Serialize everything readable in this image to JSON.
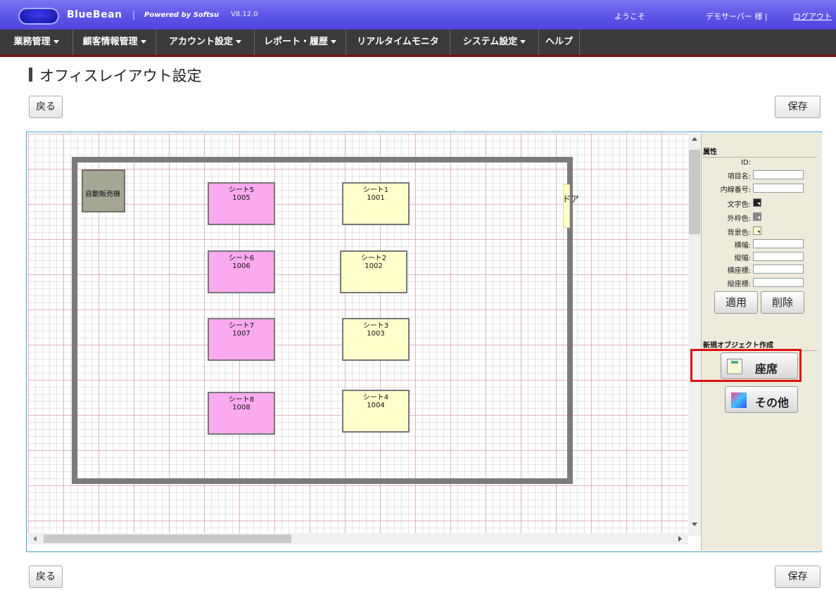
{
  "header": {
    "brand": "BlueBean",
    "separator": "|",
    "powered": "Powered by Softsu",
    "version": "V8.12.0",
    "welcome": "ようこそ",
    "user": "デモサーバー 様 |",
    "logout": "ログアウト",
    "colors": {
      "header_bg": "#5b52e6",
      "nav_bg": "#3a3a3a"
    }
  },
  "nav": {
    "items": [
      {
        "label": "業務管理",
        "dropdown": true
      },
      {
        "label": "顧客情報管理",
        "dropdown": true
      },
      {
        "label": "アカウント設定",
        "dropdown": true
      },
      {
        "label": "レポート・履歴",
        "dropdown": true
      },
      {
        "label": "リアルタイムモニタ",
        "dropdown": false
      },
      {
        "label": "システム設定",
        "dropdown": true
      },
      {
        "label": "ヘルプ",
        "dropdown": false
      }
    ]
  },
  "page": {
    "title": "オフィスレイアウト設定",
    "back_label": "戻る",
    "save_label": "保存"
  },
  "layout": {
    "vending_label": "自動販売機",
    "door_label": "ドア",
    "seats": [
      {
        "name": "シート5",
        "ext": "1005",
        "color": "pink"
      },
      {
        "name": "シート1",
        "ext": "1001",
        "color": "yellow"
      },
      {
        "name": "シート6",
        "ext": "1006",
        "color": "pink"
      },
      {
        "name": "シート2",
        "ext": "1002",
        "color": "yellow"
      },
      {
        "name": "シート7",
        "ext": "1007",
        "color": "pink"
      },
      {
        "name": "シート3",
        "ext": "1003",
        "color": "yellow"
      },
      {
        "name": "シート8",
        "ext": "1008",
        "color": "pink"
      },
      {
        "name": "シート4",
        "ext": "1004",
        "color": "yellow"
      }
    ],
    "colors": {
      "pink": "#fbaaf0",
      "yellow": "#ffffcc",
      "wall": "#7b7b7b",
      "vending": "#a6a694"
    }
  },
  "panel": {
    "heading": "属性",
    "id_label": "ID:",
    "item_name_label": "項目名:",
    "extension_label": "内線番号:",
    "text_color_label": "文字色:",
    "border_color_label": "外枠色:",
    "bg_color_label": "背景色:",
    "width_label": "横幅:",
    "height_label": "縦幅:",
    "x_label": "横座標:",
    "y_label": "縦座標:",
    "apply_label": "適用",
    "delete_label": "削除",
    "new_object_heading": "新規オブジェクト作成",
    "seat_button": "座席",
    "other_button": "その他",
    "swatch_colors": {
      "text": "#222222",
      "border": "#888888",
      "background": "#ffffcc"
    }
  }
}
